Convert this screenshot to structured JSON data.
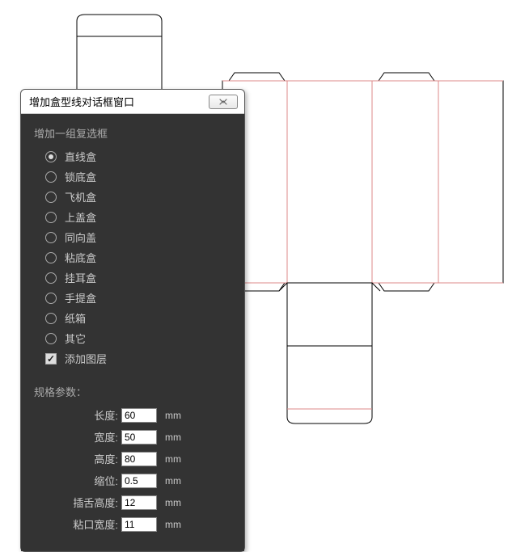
{
  "dialog": {
    "title": "增加盒型线对话框窗口",
    "closeLabel": "✕"
  },
  "boxTypes": {
    "groupLabel": "增加一组复选框",
    "options": [
      {
        "label": "直线盒",
        "selected": true
      },
      {
        "label": "锁底盒",
        "selected": false
      },
      {
        "label": "飞机盒",
        "selected": false
      },
      {
        "label": "上盖盒",
        "selected": false
      },
      {
        "label": "同向盖",
        "selected": false
      },
      {
        "label": "粘底盒",
        "selected": false
      },
      {
        "label": "挂耳盒",
        "selected": false
      },
      {
        "label": "手提盒",
        "selected": false
      },
      {
        "label": "纸箱",
        "selected": false
      },
      {
        "label": "其它",
        "selected": false
      }
    ],
    "addLayer": {
      "label": "添加图层",
      "checked": true
    }
  },
  "params": {
    "groupLabel": "规格参数：",
    "unit": "mm",
    "fields": [
      {
        "label": "长度:",
        "value": "60"
      },
      {
        "label": "宽度:",
        "value": "50"
      },
      {
        "label": "高度:",
        "value": "80"
      },
      {
        "label": "缩位:",
        "value": "0.5"
      },
      {
        "label": "插舌高度:",
        "value": "12"
      },
      {
        "label": "粘口宽度:",
        "value": "11"
      }
    ]
  }
}
